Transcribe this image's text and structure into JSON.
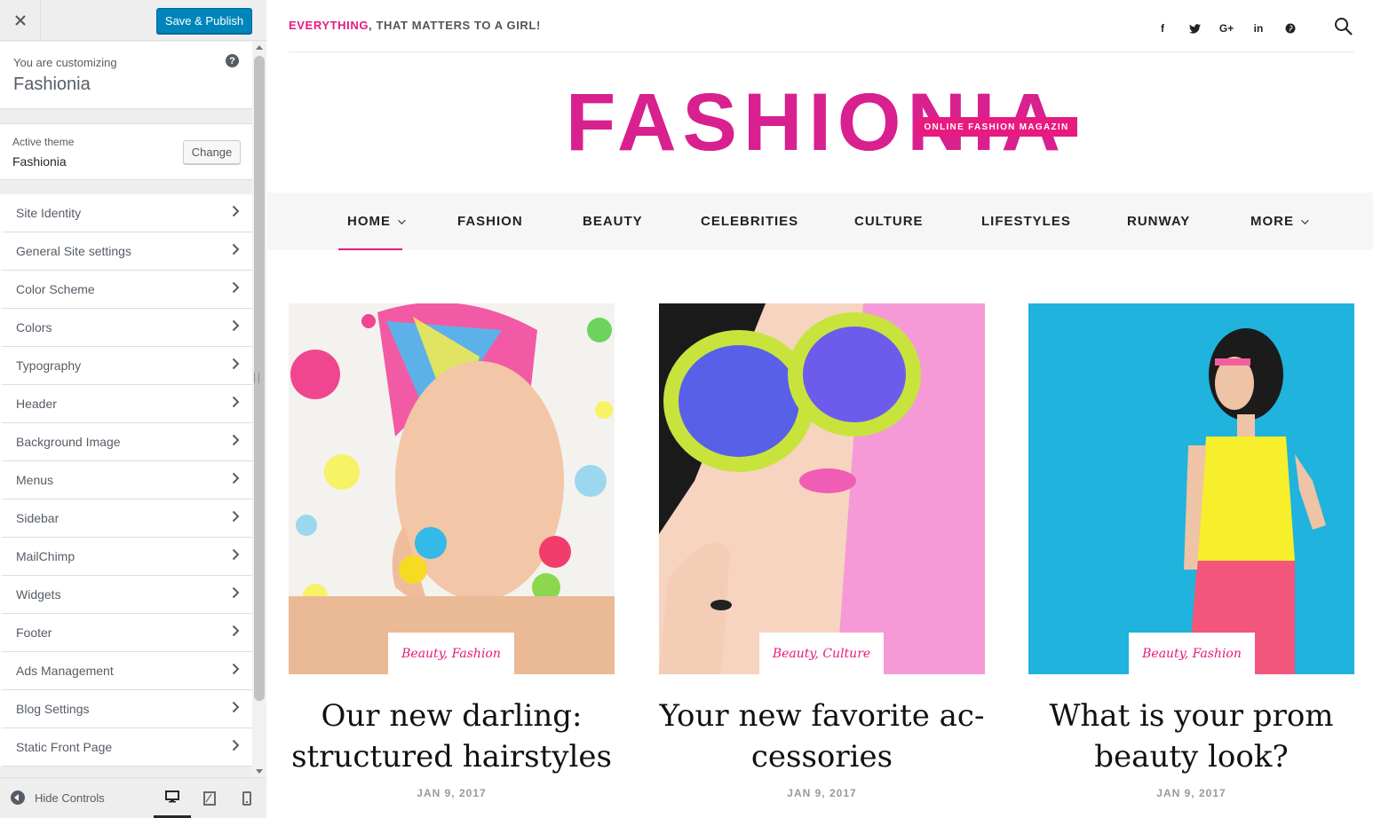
{
  "customizer": {
    "close_icon": "close-icon",
    "save_label": "Save & Publish",
    "customizing_label": "You are customizing",
    "site_name": "Fashionia",
    "help_glyph": "?",
    "active_theme_label": "Active theme",
    "active_theme_name": "Fashionia",
    "change_label": "Change",
    "sections": [
      {
        "label": "Site Identity"
      },
      {
        "label": "General Site settings"
      },
      {
        "label": "Color Scheme"
      },
      {
        "label": "Colors"
      },
      {
        "label": "Typography"
      },
      {
        "label": "Header"
      },
      {
        "label": "Background Image"
      },
      {
        "label": "Menus"
      },
      {
        "label": "Sidebar"
      },
      {
        "label": "MailChimp"
      },
      {
        "label": "Widgets"
      },
      {
        "label": "Footer"
      },
      {
        "label": "Ads Management"
      },
      {
        "label": "Blog Settings"
      },
      {
        "label": "Static Front Page"
      }
    ],
    "hide_controls_label": "Hide Controls",
    "devices": [
      "desktop-icon",
      "tablet-icon",
      "mobile-icon"
    ],
    "primary_color": "#0085ba"
  },
  "site": {
    "tagline_accent": "EVERYTHING",
    "tagline_rest": ", THAT MATTERS TO A GIRL!",
    "social": [
      {
        "icon": "facebook-icon",
        "glyph": "f"
      },
      {
        "icon": "twitter-icon",
        "glyph": "t"
      },
      {
        "icon": "google-plus-icon",
        "glyph": "G+"
      },
      {
        "icon": "linkedin-icon",
        "glyph": "in"
      },
      {
        "icon": "pinterest-icon",
        "glyph": "p"
      }
    ],
    "logo_text": "FASHIONIA",
    "logo_strip": "ONLINE FASHION MAGAZIN",
    "accent_color": "#e8197f",
    "nav": [
      {
        "label": "HOME",
        "caret": true,
        "active": true
      },
      {
        "label": "FASHION"
      },
      {
        "label": "BEAUTY"
      },
      {
        "label": "CELEBRITIES"
      },
      {
        "label": "CULTURE"
      },
      {
        "label": "LIFESTYLES"
      },
      {
        "label": "RUNWAY"
      },
      {
        "label": "MORE",
        "caret": true
      }
    ],
    "posts": [
      {
        "categories": "Beauty, Fashion",
        "title": "Our new darling: structured hairstyles",
        "date": "JAN 9, 2017"
      },
      {
        "categories": "Beauty, Culture",
        "title": "Your new favorite ac-cessories",
        "date": "JAN 9, 2017"
      },
      {
        "categories": "Beauty, Fashion",
        "title": "What is your prom beauty look?",
        "date": "JAN 9, 2017"
      }
    ]
  }
}
